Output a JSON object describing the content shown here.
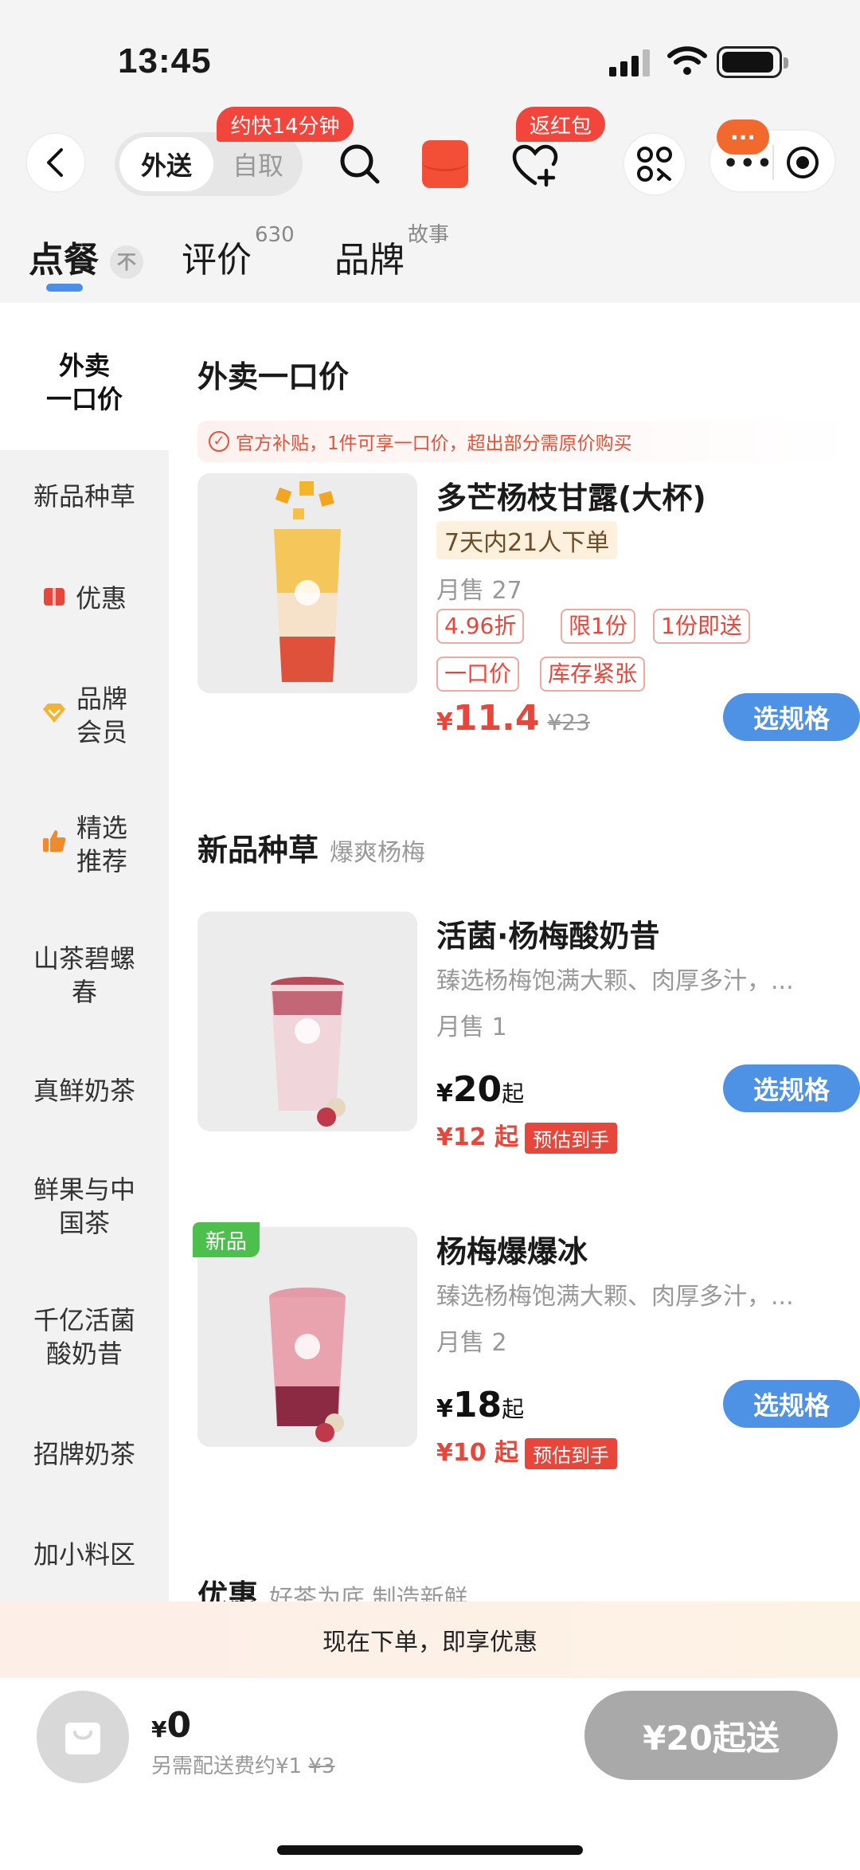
{
  "status_bar": {
    "time": "13:45"
  },
  "nav": {
    "mode_delivery": "外送",
    "mode_pickup": "自取",
    "eta_bubble": "约快14分钟",
    "redpack_bubble": "返红包",
    "msg_badge": "···"
  },
  "tabs": {
    "order": "点餐",
    "pin_label": "不",
    "review": "评价",
    "review_count": "630",
    "brand": "品牌",
    "brand_sup": "故事"
  },
  "sidebar": {
    "items": [
      {
        "line1": "外卖",
        "line2": "一口价"
      },
      {
        "label": "新品种草"
      },
      {
        "label": "优惠"
      },
      {
        "line1": "品牌",
        "line2": "会员"
      },
      {
        "line1": "精选",
        "line2": "推荐"
      },
      {
        "line1": "山茶碧螺",
        "line2": "春"
      },
      {
        "label": "真鲜奶茶"
      },
      {
        "line1": "鲜果与中",
        "line2": "国茶"
      },
      {
        "line1": "千亿活菌",
        "line2": "酸奶昔"
      },
      {
        "label": "招牌奶茶"
      },
      {
        "label": "加小料区"
      }
    ]
  },
  "sections": {
    "fixed_price": {
      "title": "外卖一口价",
      "notice": "官方补贴，1件可享一口价，超出部分需原价购买",
      "product": {
        "name": "多芒杨枝甘露(大杯)",
        "tag": "7天内21人下单",
        "sales": "月售 27",
        "badges": [
          "4.96折",
          "限1份",
          "1份即送",
          "一口价",
          "库存紧张"
        ],
        "currency": "¥",
        "price": "11.4",
        "original": "¥23",
        "button": "选规格"
      }
    },
    "new_items": {
      "title": "新品种草",
      "subtitle": "爆爽杨梅",
      "products": [
        {
          "name": "活菌·杨梅酸奶昔",
          "desc": "臻选杨梅饱满大颗、肉厚多汁，...",
          "sales": "月售 1",
          "currency": "¥",
          "price": "20",
          "suffix": "起",
          "est_price": "¥12 起",
          "est_label": "预估到手",
          "button": "选规格"
        },
        {
          "badge": "新品",
          "name": "杨梅爆爆冰",
          "desc": "臻选杨梅饱满大颗、肉厚多汁，...",
          "sales": "月售 2",
          "currency": "¥",
          "price": "18",
          "suffix": "起",
          "est_price": "¥10 起",
          "est_label": "预估到手",
          "button": "选规格"
        }
      ]
    },
    "promo": {
      "title": "优惠",
      "subtitle": "好茶为底 制造新鲜"
    }
  },
  "promo_bar": "现在下单，即享优惠",
  "cart": {
    "currency": "¥",
    "amount": "0",
    "fee_text": "另需配送费约¥1",
    "fee_old": "¥3",
    "button": "¥20起送"
  },
  "colors": {
    "accent_blue": "#4d92e4",
    "price_red": "#e8463a",
    "badge_red": "#f2463d",
    "new_green": "#4dbf4d"
  }
}
